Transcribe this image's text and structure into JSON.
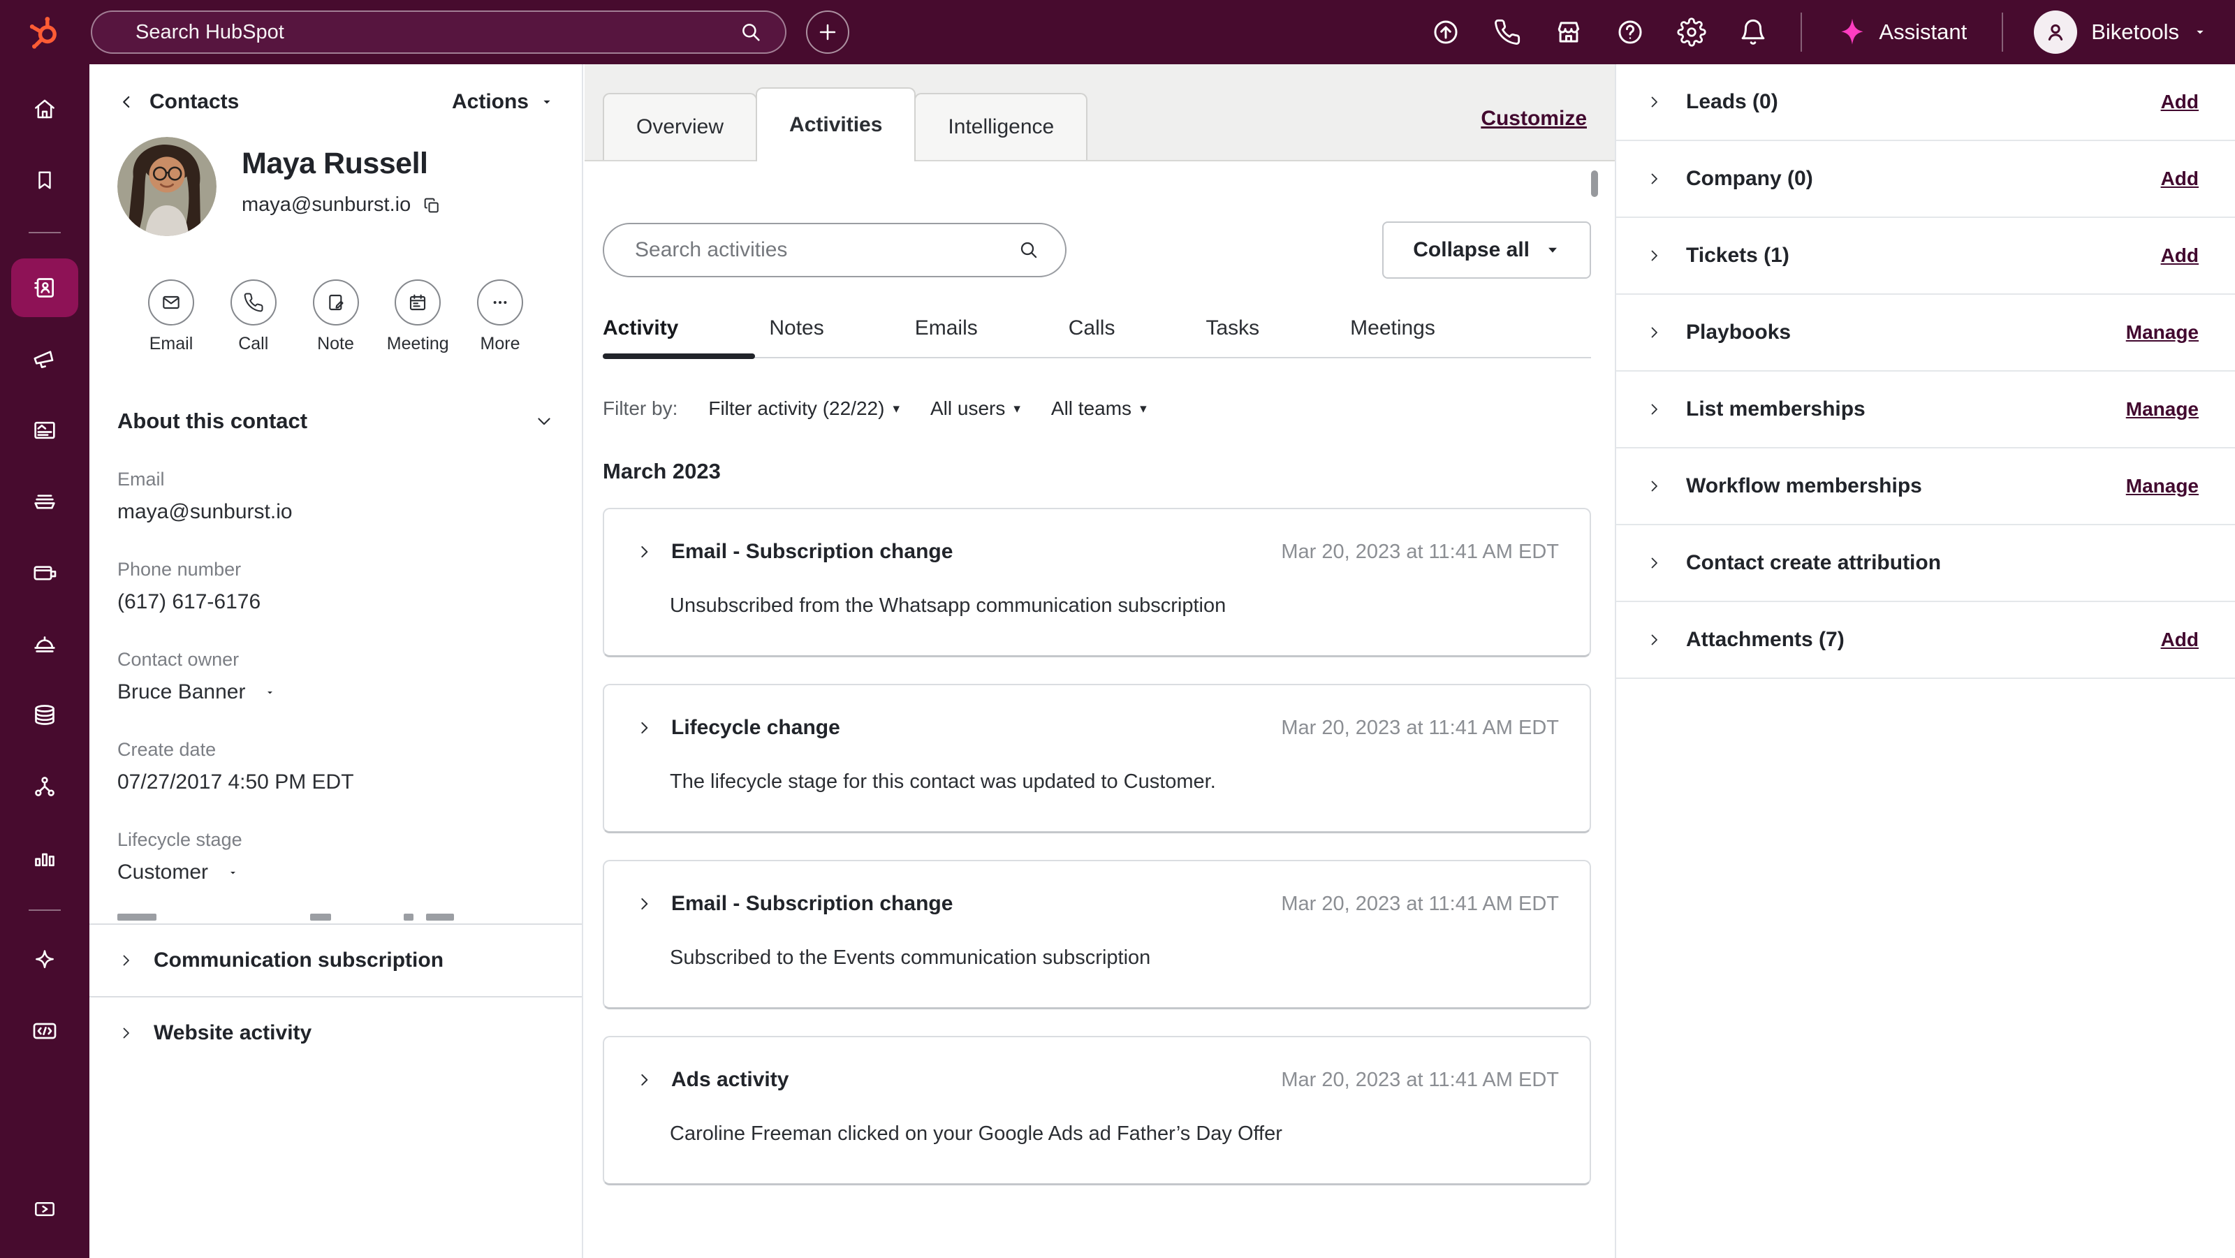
{
  "colors": {
    "topbar_bg": "#470b2e",
    "active_nav_bg": "#8e1256",
    "brand_orange": "#ff5c35",
    "assistant_pink": "#ff3dc1",
    "link_burgundy": "#42092f"
  },
  "topbar": {
    "search_placeholder": "Search HubSpot",
    "icons": [
      "upgrade-icon",
      "calling-icon",
      "marketplace-icon",
      "help-icon",
      "settings-icon",
      "notifications-icon"
    ],
    "assistant_label": "Assistant",
    "account_label": "Biketools"
  },
  "sidebar": {
    "icons": [
      "home-icon",
      "bookmarks-icon",
      "contacts-icon",
      "marketing-icon",
      "content-icon",
      "commerce-icon",
      "payments-icon",
      "service-icon",
      "data-icon",
      "automations-icon",
      "reporting-icon",
      "ai-icon",
      "developer-icon",
      "expand-panel-icon"
    ],
    "active_item": "contacts"
  },
  "contact_panel": {
    "back_label": "Contacts",
    "actions_label": "Actions",
    "name": "Maya Russell",
    "email": "maya@sunburst.io",
    "quick_actions": [
      {
        "icon": "email-icon",
        "label": "Email"
      },
      {
        "icon": "call-icon",
        "label": "Call"
      },
      {
        "icon": "note-icon",
        "label": "Note"
      },
      {
        "icon": "meeting-icon",
        "label": "Meeting"
      },
      {
        "icon": "more-icon",
        "label": "More"
      }
    ],
    "about": {
      "title": "About this contact",
      "fields": [
        {
          "label": "Email",
          "value": "maya@sunburst.io",
          "has_dropdown": false
        },
        {
          "label": "Phone number",
          "value": "(617) 617-6176",
          "has_dropdown": false
        },
        {
          "label": "Contact owner",
          "value": "Bruce Banner",
          "has_dropdown": true
        },
        {
          "label": "Create date",
          "value": "07/27/2017 4:50 PM EDT",
          "has_dropdown": false
        },
        {
          "label": "Lifecycle stage",
          "value": "Customer",
          "has_dropdown": true
        }
      ]
    },
    "sections": [
      {
        "title": "Communication subscription"
      },
      {
        "title": "Website activity"
      }
    ]
  },
  "main": {
    "tabs": [
      {
        "label": "Overview",
        "active": false
      },
      {
        "label": "Activities",
        "active": true
      },
      {
        "label": "Intelligence",
        "active": false
      }
    ],
    "customize_label": "Customize",
    "search_placeholder": "Search activities",
    "collapse_all_label": "Collapse all",
    "subtabs": [
      "Activity",
      "Notes",
      "Emails",
      "Calls",
      "Tasks",
      "Meetings"
    ],
    "active_subtab": "Activity",
    "filter": {
      "prefix": "Filter by:",
      "activity": "Filter activity (22/22)",
      "users": "All users",
      "teams": "All teams"
    },
    "month_header": "March 2023",
    "cards": [
      {
        "title": "Email - Subscription change",
        "timestamp": "Mar 20, 2023 at 11:41 AM EDT",
        "body": "Unsubscribed from the Whatsapp communication subscription"
      },
      {
        "title": "Lifecycle change",
        "timestamp": "Mar 20, 2023 at 11:41 AM EDT",
        "body": "The lifecycle stage for this contact was updated to Customer."
      },
      {
        "title": "Email - Subscription change",
        "timestamp": "Mar 20, 2023 at 11:41 AM EDT",
        "body": "Subscribed to the Events communication subscription"
      },
      {
        "title": "Ads activity",
        "timestamp": "Mar 20, 2023 at 11:41 AM EDT",
        "body": "Caroline Freeman clicked on your Google Ads ad Father’s Day Offer"
      }
    ]
  },
  "right_panel": {
    "rows": [
      {
        "label": "Leads (0)",
        "action": "Add"
      },
      {
        "label": "Company (0)",
        "action": "Add"
      },
      {
        "label": "Tickets (1)",
        "action": "Add"
      },
      {
        "label": "Playbooks",
        "action": "Manage"
      },
      {
        "label": "List memberships",
        "action": "Manage"
      },
      {
        "label": "Workflow memberships",
        "action": "Manage"
      },
      {
        "label": "Contact create attribution",
        "action": ""
      },
      {
        "label": "Attachments (7)",
        "action": "Add"
      }
    ]
  }
}
